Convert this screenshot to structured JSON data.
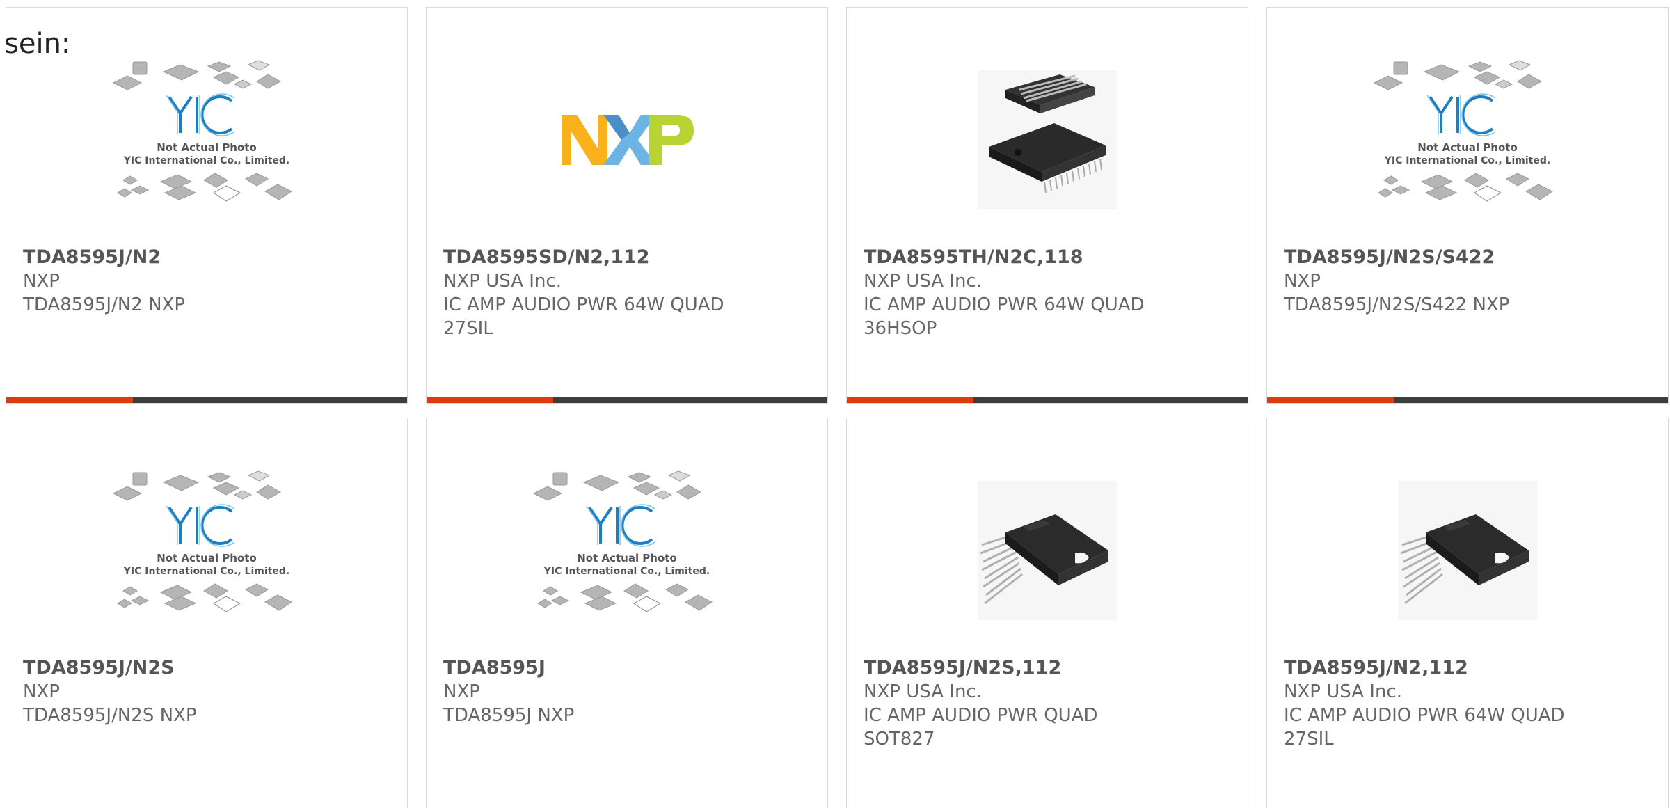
{
  "heading_fragment": "sein:",
  "placeholder_image": {
    "line1": "Not Actual Photo",
    "line2": "YIC International Co., Limited.",
    "brand": "YIC"
  },
  "nxp_logo": {
    "text": "NXP",
    "colors": [
      "#f9b21c",
      "#6cb4e4",
      "#b7d432"
    ]
  },
  "accent_color": "#e03a10",
  "bar_color": "#3d3d3d",
  "products": [
    {
      "part_number": "TDA8595J/N2",
      "manufacturer": "NXP",
      "description": "TDA8595J/N2 NXP",
      "image": "yic-placeholder"
    },
    {
      "part_number": "TDA8595SD/N2,112",
      "manufacturer": "NXP USA Inc.",
      "description": "IC AMP AUDIO PWR 64W QUAD\n27SIL",
      "image": "nxp-logo"
    },
    {
      "part_number": "TDA8595TH/N2C,118",
      "manufacturer": "NXP USA Inc.",
      "description": "IC AMP AUDIO PWR 64W QUAD\n36HSOP",
      "image": "hsop-chip"
    },
    {
      "part_number": "TDA8595J/N2S/S422",
      "manufacturer": "NXP",
      "description": "TDA8595J/N2S/S422 NXP",
      "image": "yic-placeholder"
    },
    {
      "part_number": "TDA8595J/N2S",
      "manufacturer": "NXP",
      "description": "TDA8595J/N2S NXP",
      "image": "yic-placeholder"
    },
    {
      "part_number": "TDA8595J",
      "manufacturer": "NXP",
      "description": "TDA8595J NXP",
      "image": "yic-placeholder"
    },
    {
      "part_number": "TDA8595J/N2S,112",
      "manufacturer": "NXP USA Inc.",
      "description": "IC AMP AUDIO PWR QUAD\nSOT827",
      "image": "sil-chip"
    },
    {
      "part_number": "TDA8595J/N2,112",
      "manufacturer": "NXP USA Inc.",
      "description": "IC AMP AUDIO PWR 64W QUAD\n27SIL",
      "image": "sil-chip"
    }
  ]
}
